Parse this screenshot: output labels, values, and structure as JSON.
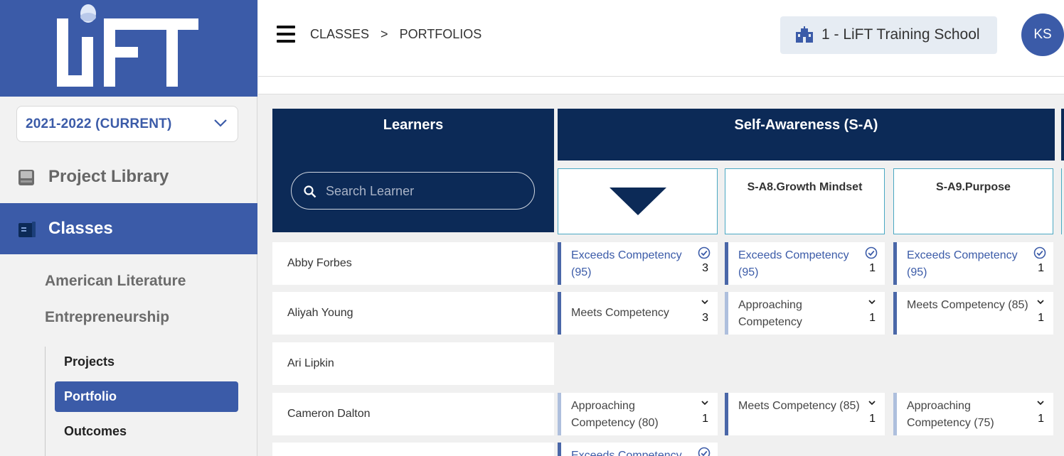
{
  "app": {
    "logo_text": "LiFT"
  },
  "sidebar": {
    "year_select": "2021-2022 (CURRENT)",
    "nav": [
      {
        "label": "Project Library",
        "icon": "book-icon"
      },
      {
        "label": "Classes",
        "icon": "class-book-icon"
      }
    ],
    "classes": [
      "American Literature",
      "Entrepreneurship"
    ],
    "sub_items": [
      "Projects",
      "Portfolio",
      "Outcomes"
    ],
    "active_sub": "Portfolio"
  },
  "header": {
    "breadcrumb": [
      "CLASSES",
      ">",
      "PORTFOLIOS"
    ],
    "school": "1 - LiFT Training School",
    "avatar_initials": "KS"
  },
  "learners_panel": {
    "title": "Learners",
    "search_placeholder": "Search Learner"
  },
  "competency_group": {
    "title": "Self-Awareness (S-A)",
    "columns": [
      "",
      "S-A8.Growth Mindset",
      "S-A9.Purpose"
    ]
  },
  "rows": [
    {
      "learner": "Abby Forbes",
      "grades": [
        {
          "text": "Exceeds Competency (95)",
          "count": "3",
          "status": "exceeds",
          "icon": "check-circle-icon"
        },
        {
          "text": "Exceeds Competency (95)",
          "count": "1",
          "status": "exceeds",
          "icon": "check-circle-icon"
        },
        {
          "text": "Exceeds Competency (95)",
          "count": "1",
          "status": "exceeds",
          "icon": "check-circle-icon"
        }
      ]
    },
    {
      "learner": "Aliyah Young",
      "grades": [
        {
          "text": "Meets Competency",
          "count": "3",
          "status": "meets",
          "icon": "chevron-down-icon"
        },
        {
          "text": "Approaching Competency",
          "count": "1",
          "status": "approaching",
          "icon": "chevron-down-icon"
        },
        {
          "text": "Meets Competency (85)",
          "count": "1",
          "status": "meets",
          "icon": "chevron-down-icon"
        }
      ]
    },
    {
      "learner": "Ari Lipkin",
      "grades": []
    },
    {
      "learner": "Cameron Dalton",
      "grades": [
        {
          "text": "Approaching Competency (80)",
          "count": "1",
          "status": "approaching",
          "icon": "chevron-down-icon"
        },
        {
          "text": "Meets Competency (85)",
          "count": "1",
          "status": "meets",
          "icon": "chevron-down-icon"
        },
        {
          "text": "Approaching Competency (75)",
          "count": "1",
          "status": "approaching",
          "icon": "chevron-down-icon"
        }
      ]
    },
    {
      "learner": "",
      "grades": [
        {
          "text": "Exceeds Competency",
          "count": "",
          "status": "exceeds",
          "icon": "check-circle-icon"
        }
      ]
    }
  ],
  "colors": {
    "brand": "#3b5ba8",
    "navy": "#0c2a57",
    "exceeds_text": "#3b5ba8",
    "meets_bar": "#4a67a8",
    "approaching_bar": "#aebfdd"
  }
}
